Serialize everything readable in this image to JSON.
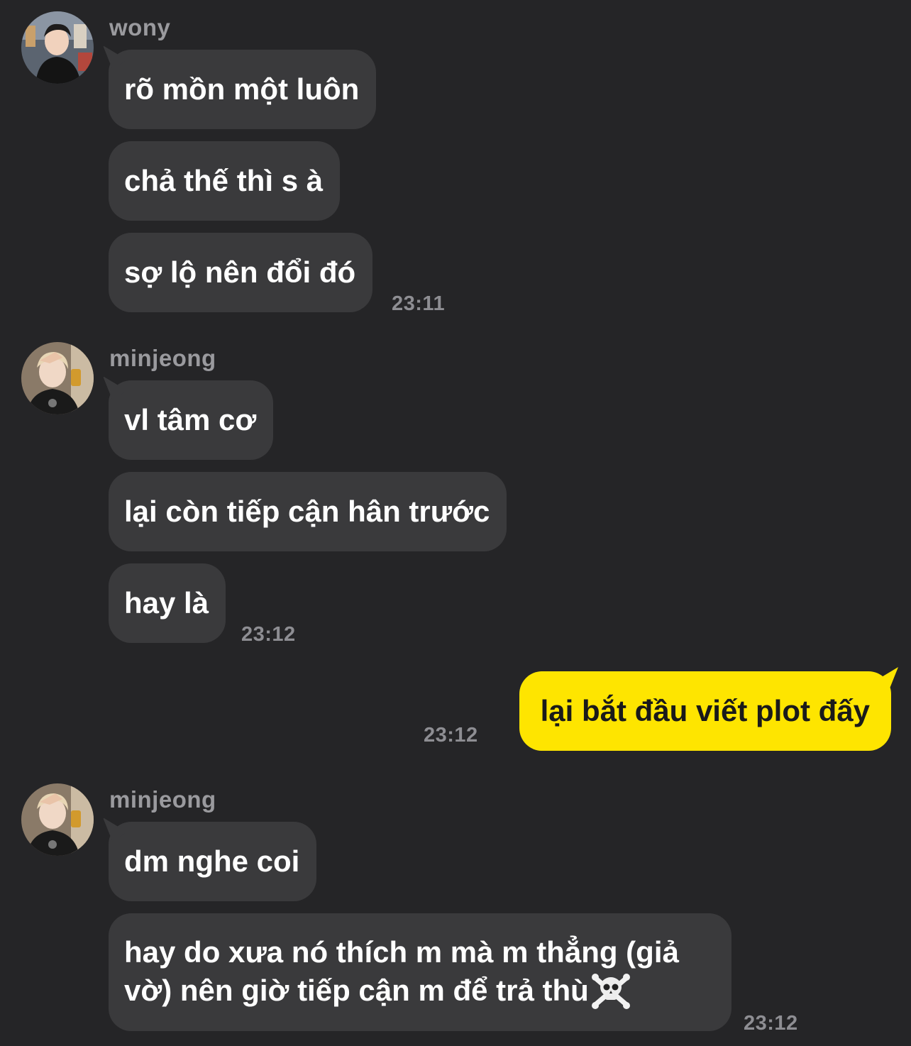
{
  "groups": [
    {
      "sender": "wony",
      "avatar_icon": "avatar-wony",
      "messages": [
        "rõ mồn một luôn",
        "chả thế thì s à",
        "sợ lộ nên đổi đó"
      ],
      "time": "23:11"
    },
    {
      "sender": "minjeong",
      "avatar_icon": "avatar-minjeong",
      "messages": [
        "vl tâm cơ",
        "lại còn tiếp cận hân trước",
        "hay là"
      ],
      "time": "23:12"
    },
    {
      "sender": "me",
      "messages": [
        "lại bắt đầu viết plot đấy"
      ],
      "time": "23:12"
    },
    {
      "sender": "minjeong",
      "avatar_icon": "avatar-minjeong",
      "messages": [
        "dm nghe coi",
        "hay do xưa nó thích m mà m thẳng (giả vờ) nên giờ tiếp cận m để trả thù"
      ],
      "emoji_icon": "skull-crossbones-icon",
      "time": "23:12"
    }
  ],
  "colors": {
    "background": "#252527",
    "incoming_bubble": "#3a3a3c",
    "outgoing_bubble": "#fee500",
    "timestamp": "#8e8e93"
  }
}
